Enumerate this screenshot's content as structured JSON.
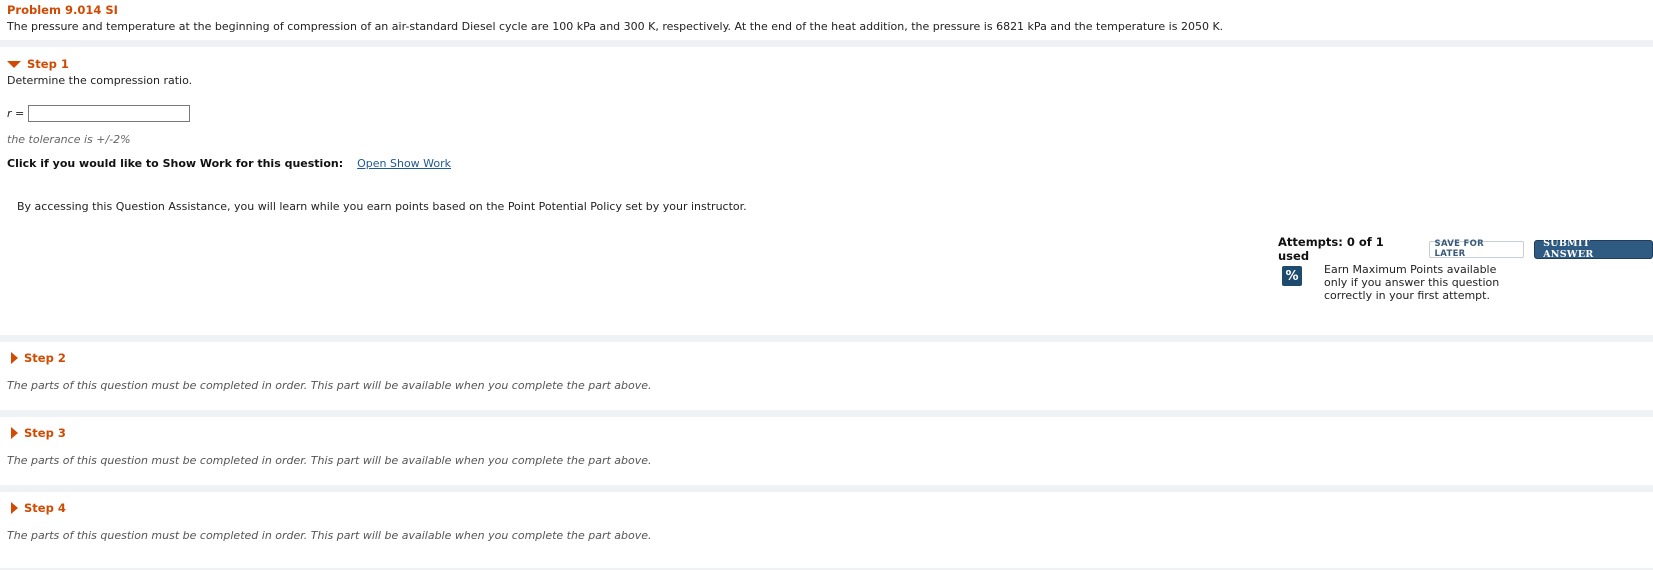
{
  "problem": {
    "title": "Problem 9.014 SI",
    "text": "The pressure and temperature at the beginning of compression of an air-standard Diesel cycle are 100 kPa and 300 K, respectively. At the end of the heat addition, the pressure is 6821 kPa and the temperature is 2050 K."
  },
  "step1": {
    "title": "Step 1",
    "prompt": "Determine the compression ratio.",
    "input_label": "r =",
    "input_value": "",
    "tolerance": "the tolerance is +/-2%",
    "show_work_label": "Click if you would like to Show Work for this question:",
    "show_work_link": "Open Show Work",
    "assistance_text": "By accessing this Question Assistance, you will learn while you earn points based on the Point Potential Policy set by your instructor.",
    "attempts": "Attempts: 0 of 1 used",
    "save_label": "SAVE FOR LATER",
    "submit_label": "SUBMIT ANSWER",
    "percent_icon_glyph": "%",
    "earn_line1": "Earn Maximum Points available",
    "earn_line2": "only if you answer this question",
    "earn_line3": "correctly in your first attempt."
  },
  "steps": [
    {
      "title": "Step 2",
      "message": "The parts of this question must be completed in order. This part will be available when you complete the part above."
    },
    {
      "title": "Step 3",
      "message": "The parts of this question must be completed in order. This part will be available when you complete the part above."
    },
    {
      "title": "Step 4",
      "message": "The parts of this question must be completed in order. This part will be available when you complete the part above."
    }
  ],
  "icons": {
    "expanded": "triangle-down-icon",
    "collapsed": "triangle-right-icon",
    "percent": "percent-icon"
  },
  "colors": {
    "accent": "#d04a02",
    "link": "#1f5a92",
    "submit_bg": "#2f5a82",
    "page_bg": "#eef2f4"
  }
}
